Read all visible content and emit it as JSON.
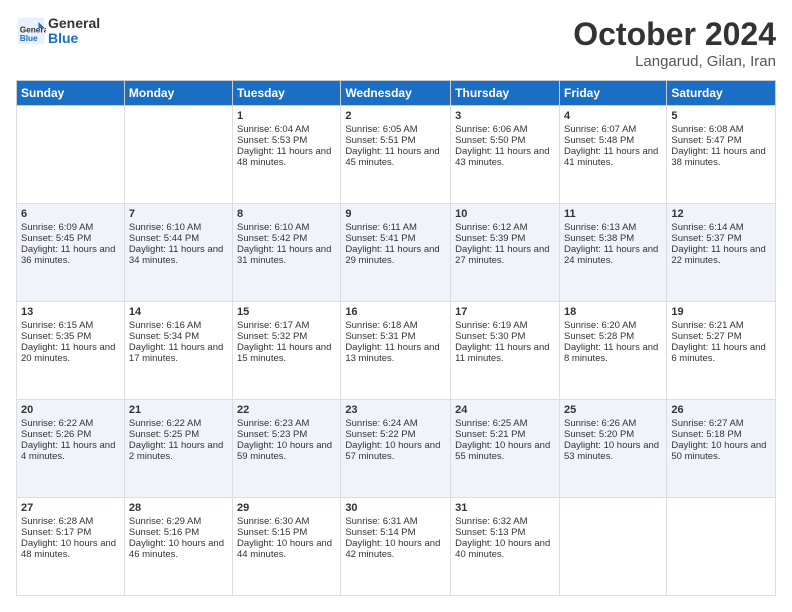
{
  "header": {
    "logo_text_general": "General",
    "logo_text_blue": "Blue",
    "title": "October 2024",
    "subtitle": "Langarud, Gilan, Iran"
  },
  "days_of_week": [
    "Sunday",
    "Monday",
    "Tuesday",
    "Wednesday",
    "Thursday",
    "Friday",
    "Saturday"
  ],
  "weeks": [
    [
      {
        "day": "",
        "sunrise": "",
        "sunset": "",
        "daylight": ""
      },
      {
        "day": "",
        "sunrise": "",
        "sunset": "",
        "daylight": ""
      },
      {
        "day": "1",
        "sunrise": "Sunrise: 6:04 AM",
        "sunset": "Sunset: 5:53 PM",
        "daylight": "Daylight: 11 hours and 48 minutes."
      },
      {
        "day": "2",
        "sunrise": "Sunrise: 6:05 AM",
        "sunset": "Sunset: 5:51 PM",
        "daylight": "Daylight: 11 hours and 45 minutes."
      },
      {
        "day": "3",
        "sunrise": "Sunrise: 6:06 AM",
        "sunset": "Sunset: 5:50 PM",
        "daylight": "Daylight: 11 hours and 43 minutes."
      },
      {
        "day": "4",
        "sunrise": "Sunrise: 6:07 AM",
        "sunset": "Sunset: 5:48 PM",
        "daylight": "Daylight: 11 hours and 41 minutes."
      },
      {
        "day": "5",
        "sunrise": "Sunrise: 6:08 AM",
        "sunset": "Sunset: 5:47 PM",
        "daylight": "Daylight: 11 hours and 38 minutes."
      }
    ],
    [
      {
        "day": "6",
        "sunrise": "Sunrise: 6:09 AM",
        "sunset": "Sunset: 5:45 PM",
        "daylight": "Daylight: 11 hours and 36 minutes."
      },
      {
        "day": "7",
        "sunrise": "Sunrise: 6:10 AM",
        "sunset": "Sunset: 5:44 PM",
        "daylight": "Daylight: 11 hours and 34 minutes."
      },
      {
        "day": "8",
        "sunrise": "Sunrise: 6:10 AM",
        "sunset": "Sunset: 5:42 PM",
        "daylight": "Daylight: 11 hours and 31 minutes."
      },
      {
        "day": "9",
        "sunrise": "Sunrise: 6:11 AM",
        "sunset": "Sunset: 5:41 PM",
        "daylight": "Daylight: 11 hours and 29 minutes."
      },
      {
        "day": "10",
        "sunrise": "Sunrise: 6:12 AM",
        "sunset": "Sunset: 5:39 PM",
        "daylight": "Daylight: 11 hours and 27 minutes."
      },
      {
        "day": "11",
        "sunrise": "Sunrise: 6:13 AM",
        "sunset": "Sunset: 5:38 PM",
        "daylight": "Daylight: 11 hours and 24 minutes."
      },
      {
        "day": "12",
        "sunrise": "Sunrise: 6:14 AM",
        "sunset": "Sunset: 5:37 PM",
        "daylight": "Daylight: 11 hours and 22 minutes."
      }
    ],
    [
      {
        "day": "13",
        "sunrise": "Sunrise: 6:15 AM",
        "sunset": "Sunset: 5:35 PM",
        "daylight": "Daylight: 11 hours and 20 minutes."
      },
      {
        "day": "14",
        "sunrise": "Sunrise: 6:16 AM",
        "sunset": "Sunset: 5:34 PM",
        "daylight": "Daylight: 11 hours and 17 minutes."
      },
      {
        "day": "15",
        "sunrise": "Sunrise: 6:17 AM",
        "sunset": "Sunset: 5:32 PM",
        "daylight": "Daylight: 11 hours and 15 minutes."
      },
      {
        "day": "16",
        "sunrise": "Sunrise: 6:18 AM",
        "sunset": "Sunset: 5:31 PM",
        "daylight": "Daylight: 11 hours and 13 minutes."
      },
      {
        "day": "17",
        "sunrise": "Sunrise: 6:19 AM",
        "sunset": "Sunset: 5:30 PM",
        "daylight": "Daylight: 11 hours and 11 minutes."
      },
      {
        "day": "18",
        "sunrise": "Sunrise: 6:20 AM",
        "sunset": "Sunset: 5:28 PM",
        "daylight": "Daylight: 11 hours and 8 minutes."
      },
      {
        "day": "19",
        "sunrise": "Sunrise: 6:21 AM",
        "sunset": "Sunset: 5:27 PM",
        "daylight": "Daylight: 11 hours and 6 minutes."
      }
    ],
    [
      {
        "day": "20",
        "sunrise": "Sunrise: 6:22 AM",
        "sunset": "Sunset: 5:26 PM",
        "daylight": "Daylight: 11 hours and 4 minutes."
      },
      {
        "day": "21",
        "sunrise": "Sunrise: 6:22 AM",
        "sunset": "Sunset: 5:25 PM",
        "daylight": "Daylight: 11 hours and 2 minutes."
      },
      {
        "day": "22",
        "sunrise": "Sunrise: 6:23 AM",
        "sunset": "Sunset: 5:23 PM",
        "daylight": "Daylight: 10 hours and 59 minutes."
      },
      {
        "day": "23",
        "sunrise": "Sunrise: 6:24 AM",
        "sunset": "Sunset: 5:22 PM",
        "daylight": "Daylight: 10 hours and 57 minutes."
      },
      {
        "day": "24",
        "sunrise": "Sunrise: 6:25 AM",
        "sunset": "Sunset: 5:21 PM",
        "daylight": "Daylight: 10 hours and 55 minutes."
      },
      {
        "day": "25",
        "sunrise": "Sunrise: 6:26 AM",
        "sunset": "Sunset: 5:20 PM",
        "daylight": "Daylight: 10 hours and 53 minutes."
      },
      {
        "day": "26",
        "sunrise": "Sunrise: 6:27 AM",
        "sunset": "Sunset: 5:18 PM",
        "daylight": "Daylight: 10 hours and 50 minutes."
      }
    ],
    [
      {
        "day": "27",
        "sunrise": "Sunrise: 6:28 AM",
        "sunset": "Sunset: 5:17 PM",
        "daylight": "Daylight: 10 hours and 48 minutes."
      },
      {
        "day": "28",
        "sunrise": "Sunrise: 6:29 AM",
        "sunset": "Sunset: 5:16 PM",
        "daylight": "Daylight: 10 hours and 46 minutes."
      },
      {
        "day": "29",
        "sunrise": "Sunrise: 6:30 AM",
        "sunset": "Sunset: 5:15 PM",
        "daylight": "Daylight: 10 hours and 44 minutes."
      },
      {
        "day": "30",
        "sunrise": "Sunrise: 6:31 AM",
        "sunset": "Sunset: 5:14 PM",
        "daylight": "Daylight: 10 hours and 42 minutes."
      },
      {
        "day": "31",
        "sunrise": "Sunrise: 6:32 AM",
        "sunset": "Sunset: 5:13 PM",
        "daylight": "Daylight: 10 hours and 40 minutes."
      },
      {
        "day": "",
        "sunrise": "",
        "sunset": "",
        "daylight": ""
      },
      {
        "day": "",
        "sunrise": "",
        "sunset": "",
        "daylight": ""
      }
    ]
  ]
}
